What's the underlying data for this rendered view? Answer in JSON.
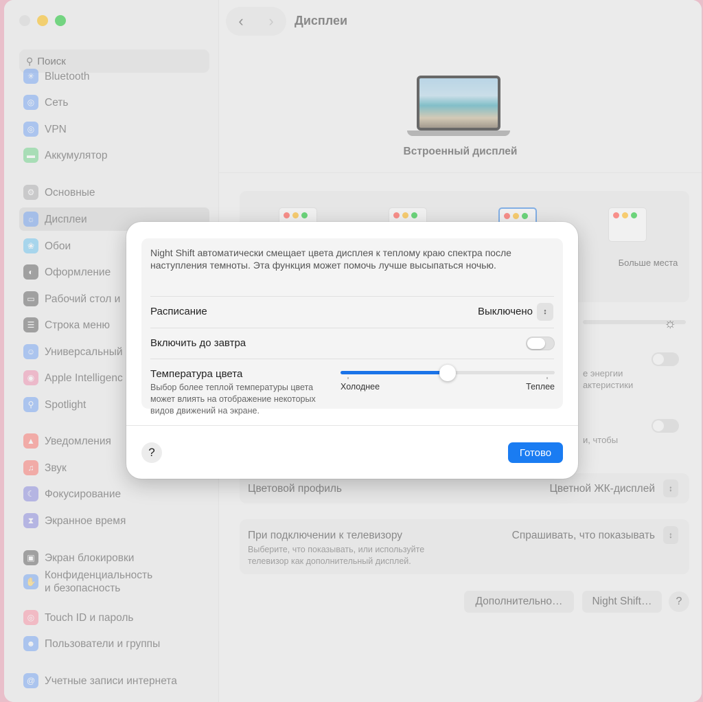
{
  "window": {
    "title": "Дисплеи"
  },
  "sidebar": {
    "search_placeholder": "Поиск",
    "items": [
      {
        "label": "Bluetooth",
        "icon": "bluetooth-icon",
        "color": "#3b82f6"
      },
      {
        "label": "Сеть",
        "icon": "globe-icon",
        "color": "#3b82f6"
      },
      {
        "label": "VPN",
        "icon": "vpn-icon",
        "color": "#3b82f6"
      },
      {
        "label": "Аккумулятор",
        "icon": "battery-icon",
        "color": "#34c759"
      },
      {
        "label": "Основные",
        "icon": "gear-icon",
        "color": "#8e8e93"
      },
      {
        "label": "Дисплеи",
        "icon": "sun-icon",
        "color": "#3b82f6"
      },
      {
        "label": "Обои",
        "icon": "flower-icon",
        "color": "#30b0f0"
      },
      {
        "label": "Оформление",
        "icon": "appearance-icon",
        "color": "#1c1c1e"
      },
      {
        "label": "Рабочий стол и",
        "icon": "desktop-icon",
        "color": "#1c1c1e"
      },
      {
        "label": "Строка меню",
        "icon": "menubar-icon",
        "color": "#1c1c1e"
      },
      {
        "label": "Универсальный",
        "icon": "accessibility-icon",
        "color": "#3b82f6"
      },
      {
        "label": "Apple Intelligenc",
        "icon": "intelligence-icon",
        "color": "#f06292"
      },
      {
        "label": "Spotlight",
        "icon": "spotlight-icon",
        "color": "#3b82f6"
      },
      {
        "label": "Уведомления",
        "icon": "bell-icon",
        "color": "#ff3b30"
      },
      {
        "label": "Звук",
        "icon": "speaker-icon",
        "color": "#ff3b30"
      },
      {
        "label": "Фокусирование",
        "icon": "moon-icon",
        "color": "#5856d6"
      },
      {
        "label": "Экранное время",
        "icon": "hourglass-icon",
        "color": "#5856d6"
      },
      {
        "label": "Экран блокировки",
        "icon": "lock-icon",
        "color": "#1c1c1e"
      },
      {
        "label": "Конфиденциальность",
        "label2": "и безопасность",
        "icon": "hand-icon",
        "color": "#3b82f6"
      },
      {
        "label": "Touch ID и пароль",
        "icon": "fingerprint-icon",
        "color": "#ff6482"
      },
      {
        "label": "Пользователи и группы",
        "icon": "users-icon",
        "color": "#3b82f6"
      },
      {
        "label": "Учетные записи интернета",
        "icon": "at-icon",
        "color": "#3b82f6"
      }
    ]
  },
  "background": {
    "hero_caption": "Встроенный дисплей",
    "more_space_label": "Больше места",
    "energy_text_1": "е энергии",
    "energy_text_2": "актеристики",
    "row3_text": "и, чтобы",
    "color_profile_label": "Цветовой профиль",
    "color_profile_value": "Цветной ЖК-дисплей",
    "tv_label": "При подключении к телевизору",
    "tv_value": "Спрашивать, что показывать",
    "tv_sub": "Выберите, что показывать, или используйте телевизор как дополнительный дисплей.",
    "advanced_button": "Дополнительно…",
    "night_shift_button": "Night Shift…",
    "help_glyph": "?"
  },
  "sheet": {
    "description": "Night Shift автоматически смещает цвета дисплея к теплому краю спектра после наступления темноты. Эта функция может помочь лучше высыпаться ночью.",
    "schedule_label": "Расписание",
    "schedule_value": "Выключено",
    "until_tomorrow_label": "Включить до завтра",
    "until_tomorrow_on": false,
    "temperature_label": "Температура цвета",
    "temperature_sub": "Выбор более теплой температуры цвета может влиять на отображение некоторых видов движений на экране.",
    "temperature_value": 0.5,
    "colder_label": "Холоднее",
    "warmer_label": "Теплее",
    "help_glyph": "?",
    "done_label": "Готово",
    "accent_color": "#1a7cf2"
  }
}
